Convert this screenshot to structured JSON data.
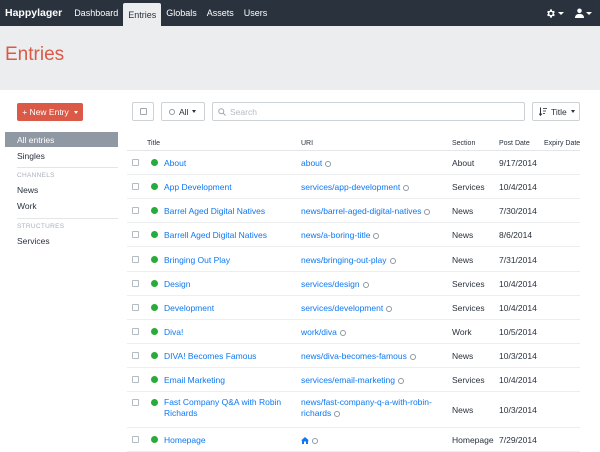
{
  "nav": {
    "brand": "Happylager",
    "items": [
      "Dashboard",
      "Entries",
      "Globals",
      "Assets",
      "Users"
    ],
    "active": "Entries",
    "settings_icon": "gear-icon",
    "user_icon": "user-icon"
  },
  "page": {
    "title": "Entries"
  },
  "sidebar": {
    "new_entry_label": "+ New Entry",
    "items": [
      {
        "label": "All entries",
        "selected": true
      },
      {
        "label": "Singles",
        "selected": false
      }
    ],
    "channels_heading": "CHANNELS",
    "channels": [
      "News",
      "Work"
    ],
    "structures_heading": "STRUCTURES",
    "structures": [
      "Services"
    ]
  },
  "toolbar": {
    "status_label": "All",
    "search_placeholder": "Search",
    "sort_label": "Title"
  },
  "table": {
    "columns": [
      "Title",
      "URI",
      "Section",
      "Post Date",
      "Expiry Date"
    ],
    "rows": [
      {
        "title": "About",
        "uri": "about",
        "section": "About",
        "post_date": "9/17/2014",
        "expiry_date": ""
      },
      {
        "title": "App Development",
        "uri": "services/app-development",
        "section": "Services",
        "post_date": "10/4/2014",
        "expiry_date": ""
      },
      {
        "title": "Barrel Aged Digital Natives",
        "uri": "news/barrel-aged-digital-natives",
        "section": "News",
        "post_date": "7/30/2014",
        "expiry_date": ""
      },
      {
        "title": "Barrell Aged Digital Natives",
        "uri": "news/a-boring-title",
        "section": "News",
        "post_date": "8/6/2014",
        "expiry_date": ""
      },
      {
        "title": "Bringing Out Play",
        "uri": "news/bringing-out-play",
        "section": "News",
        "post_date": "7/31/2014",
        "expiry_date": ""
      },
      {
        "title": "Design",
        "uri": "services/design",
        "section": "Services",
        "post_date": "10/4/2014",
        "expiry_date": ""
      },
      {
        "title": "Development",
        "uri": "services/development",
        "section": "Services",
        "post_date": "10/4/2014",
        "expiry_date": ""
      },
      {
        "title": "Diva!",
        "uri": "work/diva",
        "section": "Work",
        "post_date": "10/5/2014",
        "expiry_date": ""
      },
      {
        "title": "DIVA! Becomes Famous",
        "uri": "news/diva-becomes-famous",
        "section": "News",
        "post_date": "10/3/2014",
        "expiry_date": ""
      },
      {
        "title": "Email Marketing",
        "uri": "services/email-marketing",
        "section": "Services",
        "post_date": "10/4/2014",
        "expiry_date": ""
      },
      {
        "title": "Fast Company Q&A with Robin Richards",
        "uri": "news/fast-company-q-a-with-robin-richards",
        "section": "News",
        "post_date": "10/3/2014",
        "expiry_date": ""
      },
      {
        "title": "Homepage",
        "uri": "",
        "uri_icon": "home-icon",
        "section": "Homepage",
        "post_date": "7/29/2014",
        "expiry_date": ""
      }
    ]
  },
  "colors": {
    "accent": "#da5a47",
    "link": "#0d78f2",
    "nav_bg": "#29323d",
    "status_live": "#27ab3b",
    "selected_bg": "#8f98a3"
  }
}
